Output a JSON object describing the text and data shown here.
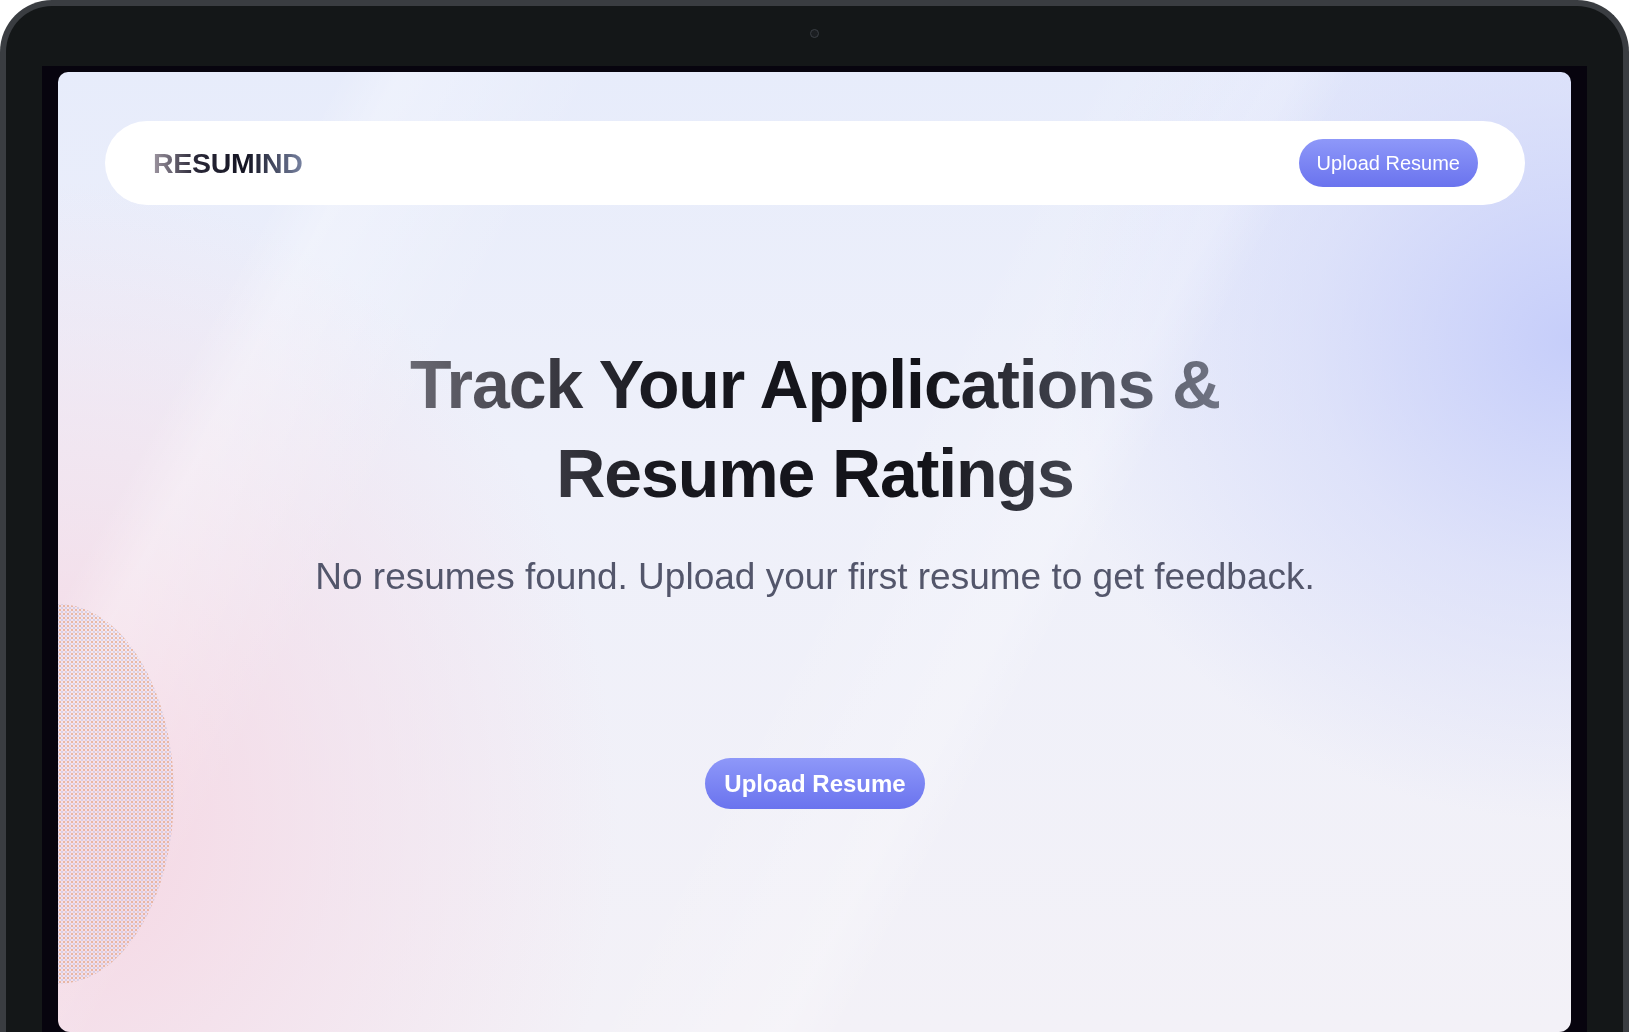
{
  "navbar": {
    "logo": "RESUMIND",
    "button": "Upload Resume"
  },
  "hero": {
    "title": "Track Your Applications & Resume Ratings",
    "subtitle": "No resumes found. Upload your first resume to get feedback.",
    "button": "Upload Resume"
  }
}
